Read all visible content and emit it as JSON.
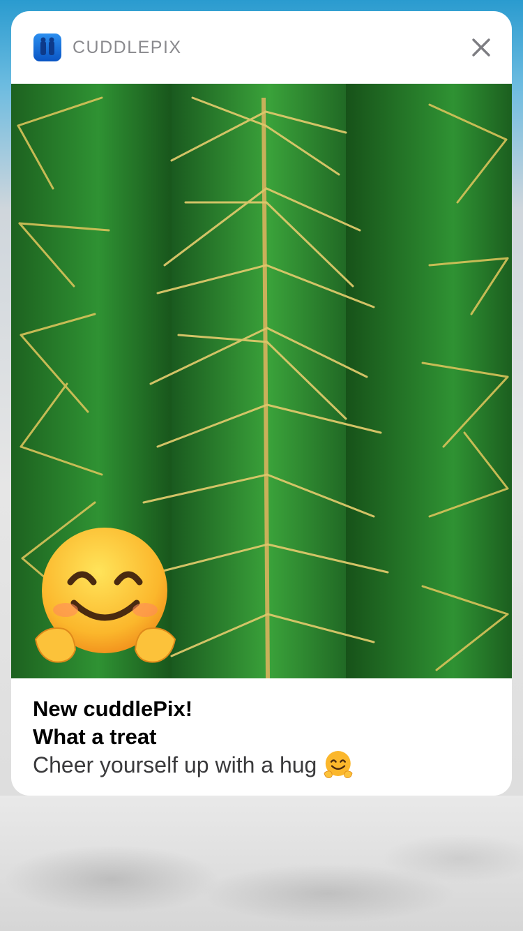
{
  "notification": {
    "app_name": "CUDDLEPIX",
    "app_icon": "cuddlepix-app-icon",
    "close_icon": "close-icon",
    "media": {
      "subject": "cactus-photo",
      "overlay_icon": "hugging-face-emoji"
    },
    "title_line1": "New cuddlePix!",
    "title_line2": "What a treat",
    "message": "Cheer yourself up with a hug",
    "message_icon": "hugging-face-emoji"
  },
  "colors": {
    "accent_blue": "#0a55c4",
    "cactus_green": "#2f8a33",
    "spine_yellow": "#d8c35a"
  }
}
